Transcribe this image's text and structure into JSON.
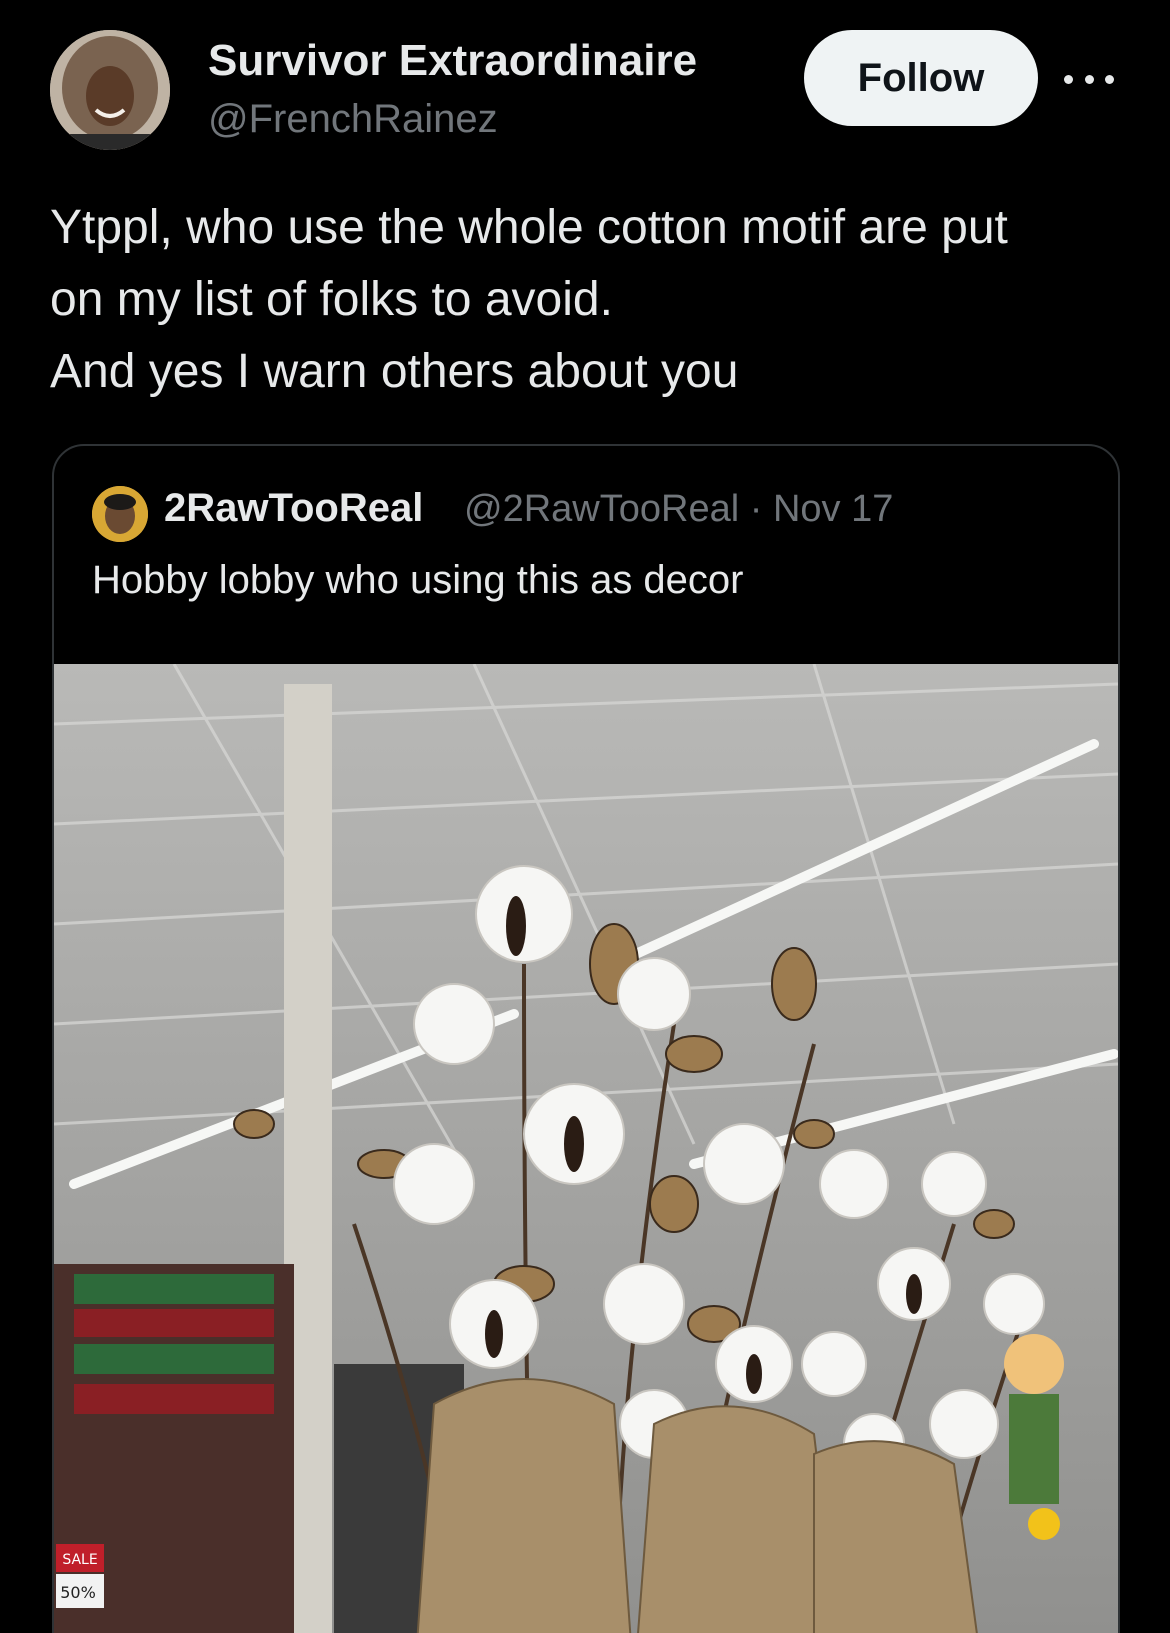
{
  "author": {
    "name": "Survivor Extraordinaire",
    "handle": "@FrenchRainez",
    "avatar_icon": "profile-photo"
  },
  "actions": {
    "follow_label": "Follow",
    "more_icon": "more-horizontal-icon"
  },
  "tweet": {
    "lines": [
      "Ytppl, who use the whole cotton motif are put",
      "on my list of folks to avoid.",
      "And yes I warn others about you"
    ]
  },
  "quote": {
    "name": "2RawTooReal",
    "handle": "@2RawTooReal",
    "separator": "·",
    "date": "Nov 17",
    "text": "Hobby lobby who using this as decor",
    "image_signs": {
      "sale": "SALE",
      "percent": "50%"
    }
  },
  "colors": {
    "background": "#000000",
    "text_primary": "#e7e9ea",
    "text_secondary": "#71767b",
    "follow_bg": "#eff3f4",
    "border": "#2f3336"
  }
}
